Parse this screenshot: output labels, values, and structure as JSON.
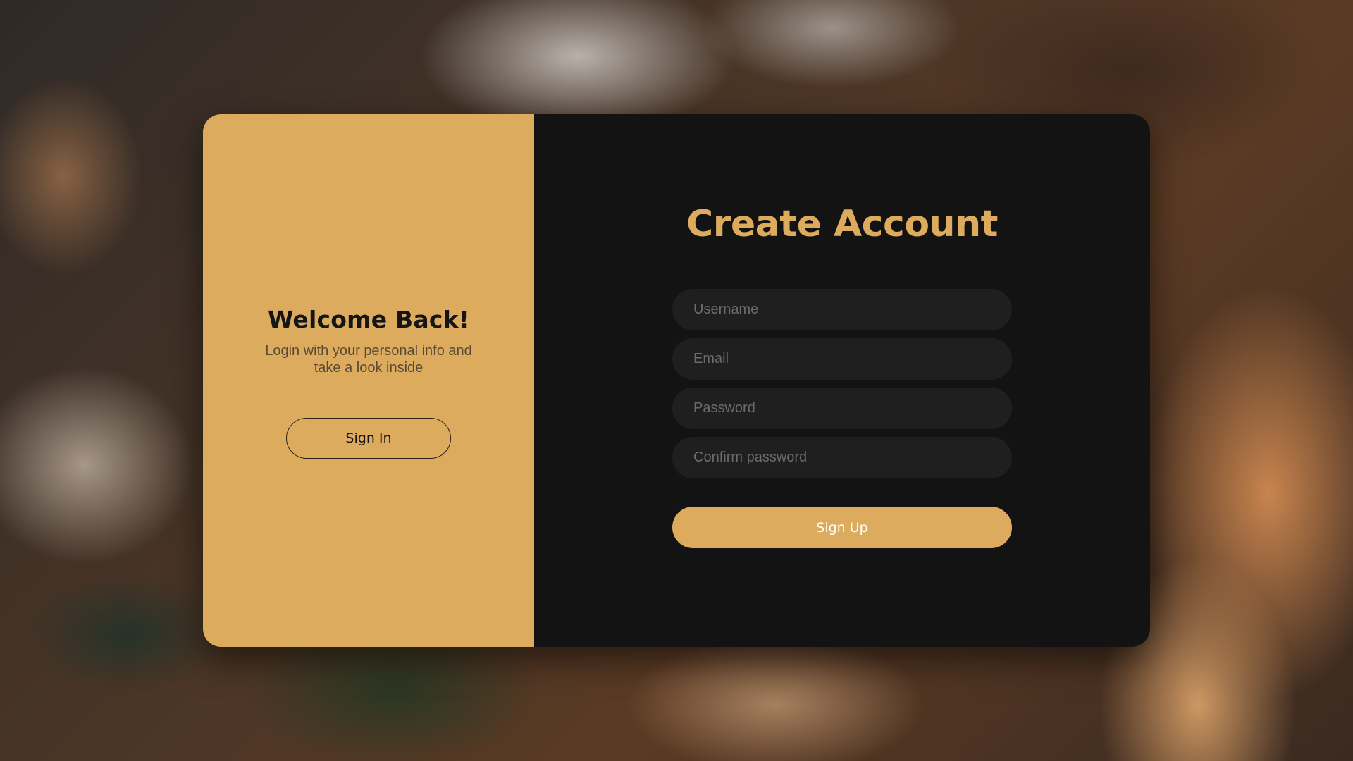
{
  "left_panel": {
    "title": "Welcome Back!",
    "subtitle_line1": "Login with your personal info and",
    "subtitle_line2": "take a look inside",
    "sign_in_label": "Sign In"
  },
  "right_panel": {
    "title": "Create Account",
    "fields": {
      "username_placeholder": "Username",
      "email_placeholder": "Email",
      "password_placeholder": "Password",
      "confirm_placeholder": "Confirm password"
    },
    "sign_up_label": "Sign Up"
  },
  "colors": {
    "accent": "#dcab5e",
    "panel_dark": "#131313",
    "input_bg": "#1f1f1f"
  }
}
